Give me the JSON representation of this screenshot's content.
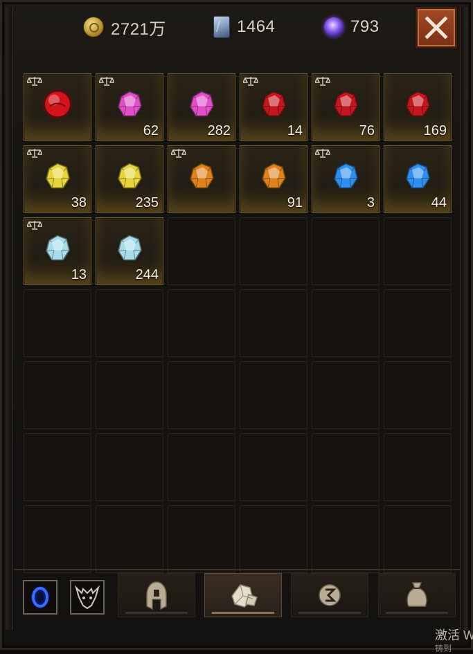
{
  "currencies": [
    {
      "icon": "gold-coin-icon",
      "value": "2721万"
    },
    {
      "icon": "scroll-icon",
      "value": "1464"
    },
    {
      "icon": "purple-orb-icon",
      "value": "793"
    }
  ],
  "close_button_label": "close",
  "inventory": {
    "rows": 7,
    "cols": 6,
    "items": [
      {
        "gem": "ruby-orb",
        "color": "#d4141a",
        "quantity": "",
        "tradable": true
      },
      {
        "gem": "amethyst-gem",
        "color": "#e04fc7",
        "quantity": "62",
        "tradable": true
      },
      {
        "gem": "amethyst-gem",
        "color": "#e04fc7",
        "quantity": "282",
        "tradable": false
      },
      {
        "gem": "ruby-gem",
        "color": "#c3161f",
        "quantity": "14",
        "tradable": true
      },
      {
        "gem": "ruby-gem",
        "color": "#c3161f",
        "quantity": "76",
        "tradable": true
      },
      {
        "gem": "ruby-gem",
        "color": "#c3161f",
        "quantity": "169",
        "tradable": false
      },
      {
        "gem": "topaz-gem",
        "color": "#e7d33a",
        "quantity": "38",
        "tradable": true
      },
      {
        "gem": "topaz-gem",
        "color": "#e7d33a",
        "quantity": "235",
        "tradable": false
      },
      {
        "gem": "amber-gem",
        "color": "#e0821c",
        "quantity": "",
        "tradable": true
      },
      {
        "gem": "amber-gem",
        "color": "#e0821c",
        "quantity": "91",
        "tradable": false
      },
      {
        "gem": "sapphire-gem",
        "color": "#2f8ff0",
        "quantity": "3",
        "tradable": true
      },
      {
        "gem": "sapphire-gem",
        "color": "#2f8ff0",
        "quantity": "44",
        "tradable": false
      },
      {
        "gem": "diamond-gem",
        "color": "#a8dcea",
        "quantity": "13",
        "tradable": true
      },
      {
        "gem": "diamond-gem",
        "color": "#a8dcea",
        "quantity": "244",
        "tradable": false
      }
    ]
  },
  "quick_slots": [
    {
      "icon": "blue-portal-icon"
    },
    {
      "icon": "demon-head-icon"
    }
  ],
  "tabs": [
    {
      "icon": "helmet-icon",
      "active": false
    },
    {
      "icon": "gem-tab-icon",
      "active": true
    },
    {
      "icon": "rune-icon",
      "active": false
    },
    {
      "icon": "money-bag-icon",
      "active": false
    }
  ],
  "footer": {
    "text": "激活 W",
    "subtext": "铸到"
  }
}
